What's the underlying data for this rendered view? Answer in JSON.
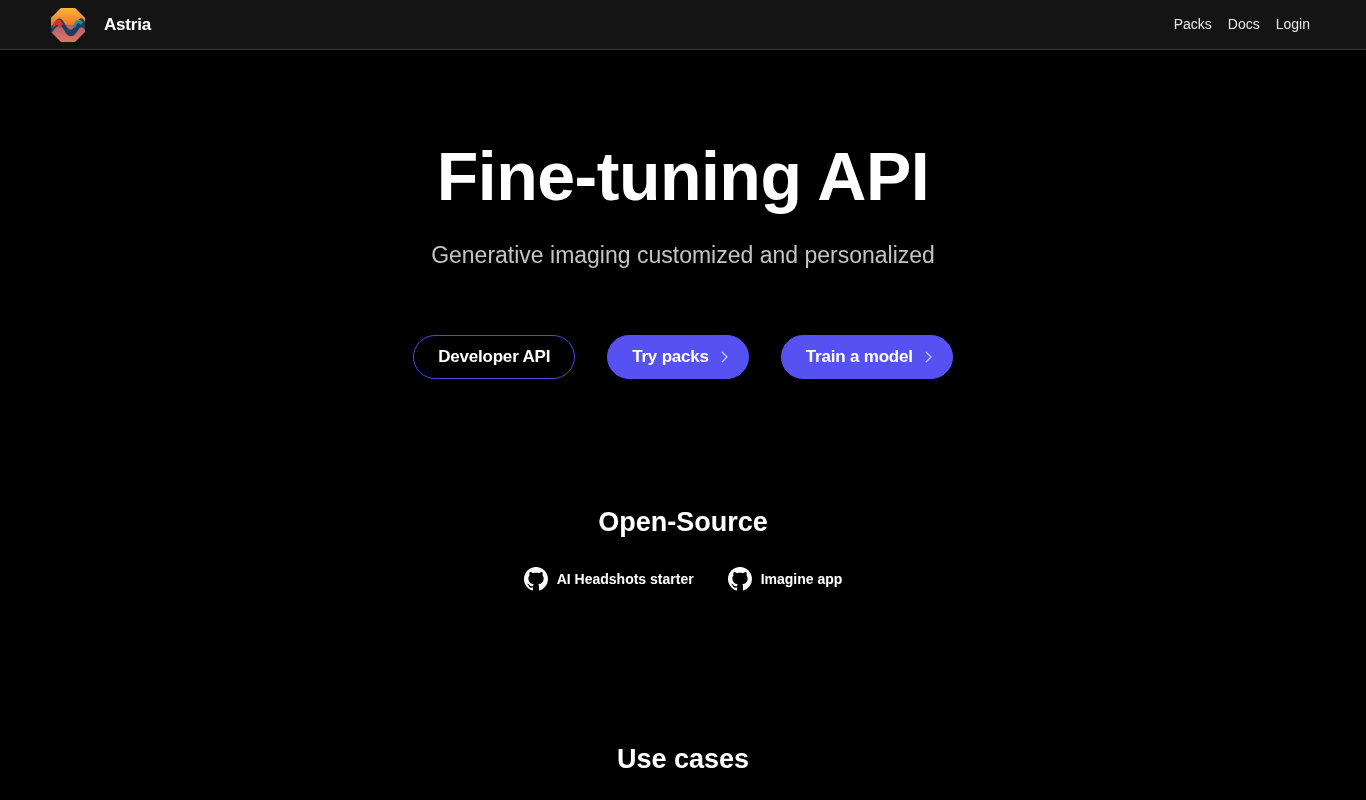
{
  "navbar": {
    "brand": "Astria",
    "links": [
      "Packs",
      "Docs",
      "Login"
    ]
  },
  "hero": {
    "title": "Fine-tuning API",
    "subtitle": "Generative imaging customized and personalized",
    "buttons": [
      {
        "label": "Developer API",
        "kind": "outline"
      },
      {
        "label": "Try packs",
        "kind": "primary"
      },
      {
        "label": "Train a model",
        "kind": "primary"
      }
    ]
  },
  "open_source": {
    "heading": "Open-Source",
    "links": [
      "AI Headshots starter",
      "Imagine app"
    ]
  },
  "use_cases": {
    "heading": "Use cases"
  }
}
